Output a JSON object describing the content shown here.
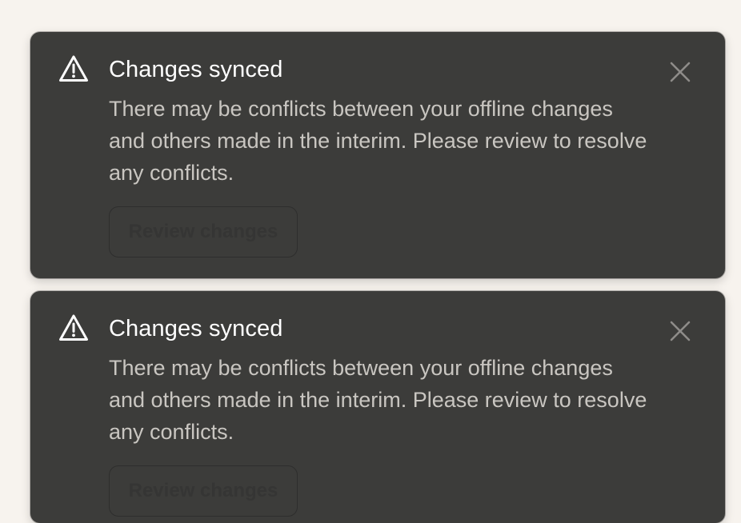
{
  "toasts": [
    {
      "icon": "warning-triangle-icon",
      "title": "Changes synced",
      "message": "There may be conflicts between your offline changes and others made in the interim. Please review to resolve any conflicts.",
      "action_label": "Review changes",
      "close_icon": "close-icon"
    },
    {
      "icon": "warning-triangle-icon",
      "title": "Changes synced",
      "message": "There may be conflicts between your offline changes and others made in the interim. Please review to resolve any conflicts.",
      "action_label": "Review changes",
      "close_icon": "close-icon"
    }
  ],
  "colors": {
    "page_background": "#f7f3ee",
    "toast_background": "#3c3c3a",
    "title_text": "#ffffff",
    "body_text": "#c9c6c1"
  }
}
